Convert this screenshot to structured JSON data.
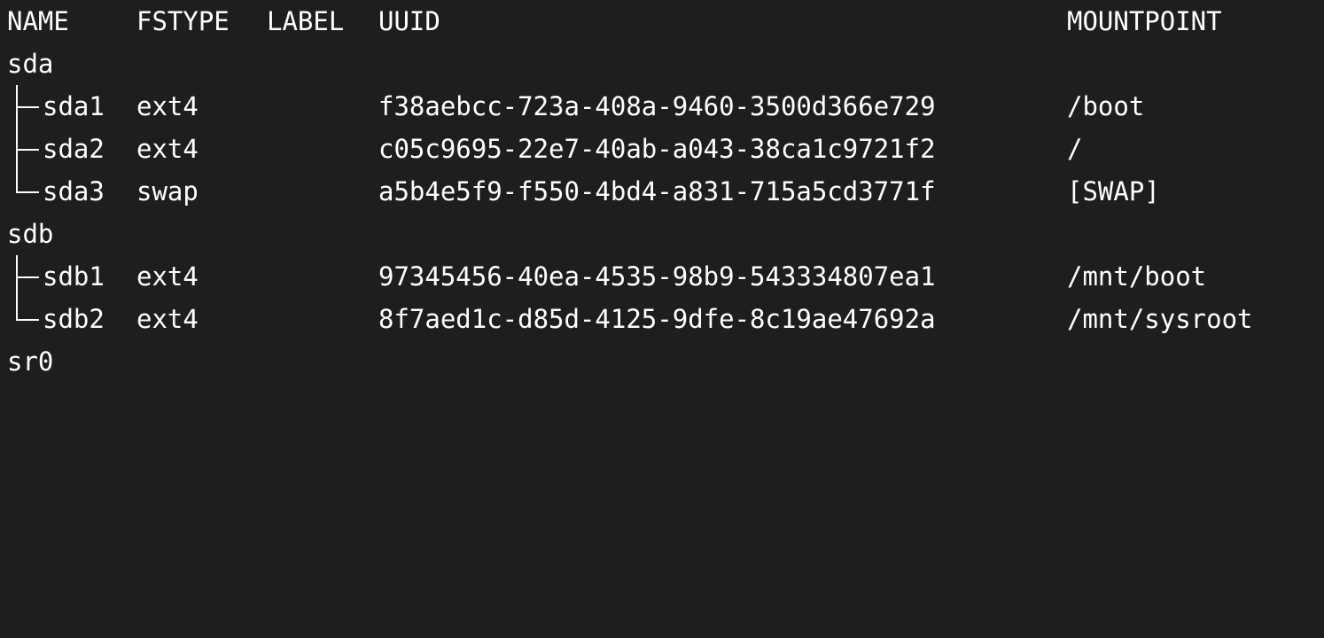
{
  "terminal": {
    "header": {
      "name": "NAME",
      "fstype": "FSTYPE",
      "label": "LABEL",
      "uuid": "UUID",
      "mountpoint": "MOUNTPOINT"
    },
    "devices": [
      {
        "name": "sda",
        "children": [
          {
            "name": "sda1",
            "fstype": "ext4",
            "label": "",
            "uuid": "f38aebcc-723a-408a-9460-3500d366e729",
            "mountpoint": "/boot"
          },
          {
            "name": "sda2",
            "fstype": "ext4",
            "label": "",
            "uuid": "c05c9695-22e7-40ab-a043-38ca1c9721f2",
            "mountpoint": "/"
          },
          {
            "name": "sda3",
            "fstype": "swap",
            "label": "",
            "uuid": "a5b4e5f9-f550-4bd4-a831-715a5cd3771f",
            "mountpoint": "[SWAP]"
          }
        ]
      },
      {
        "name": "sdb",
        "children": [
          {
            "name": "sdb1",
            "fstype": "ext4",
            "label": "",
            "uuid": "97345456-40ea-4535-98b9-543334807ea1",
            "mountpoint": "/mnt/boot"
          },
          {
            "name": "sdb2",
            "fstype": "ext4",
            "label": "",
            "uuid": "8f7aed1c-d85d-4125-9dfe-8c19ae47692a",
            "mountpoint": "/mnt/sysroot"
          }
        ]
      },
      {
        "name": "sr0",
        "children": []
      }
    ]
  }
}
